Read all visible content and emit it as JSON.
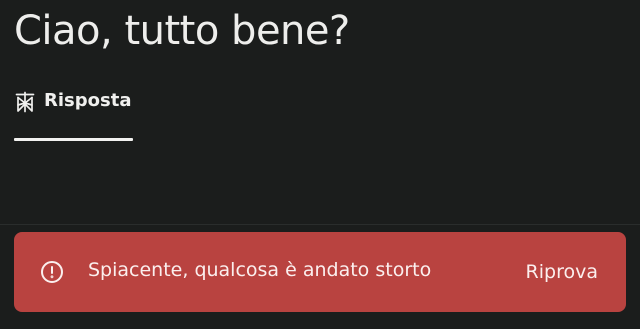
{
  "query": {
    "title": "Ciao, tutto bene?"
  },
  "tabs": [
    {
      "label": "Risposta",
      "icon": "answer-icon",
      "active": true
    }
  ],
  "error": {
    "icon": "alert-circle-icon",
    "message": "Spiacente, qualcosa è andato storto",
    "retry_label": "Riprova",
    "color": "#b94340"
  },
  "theme": {
    "background": "#1b1d1c",
    "text": "#ededeb"
  }
}
